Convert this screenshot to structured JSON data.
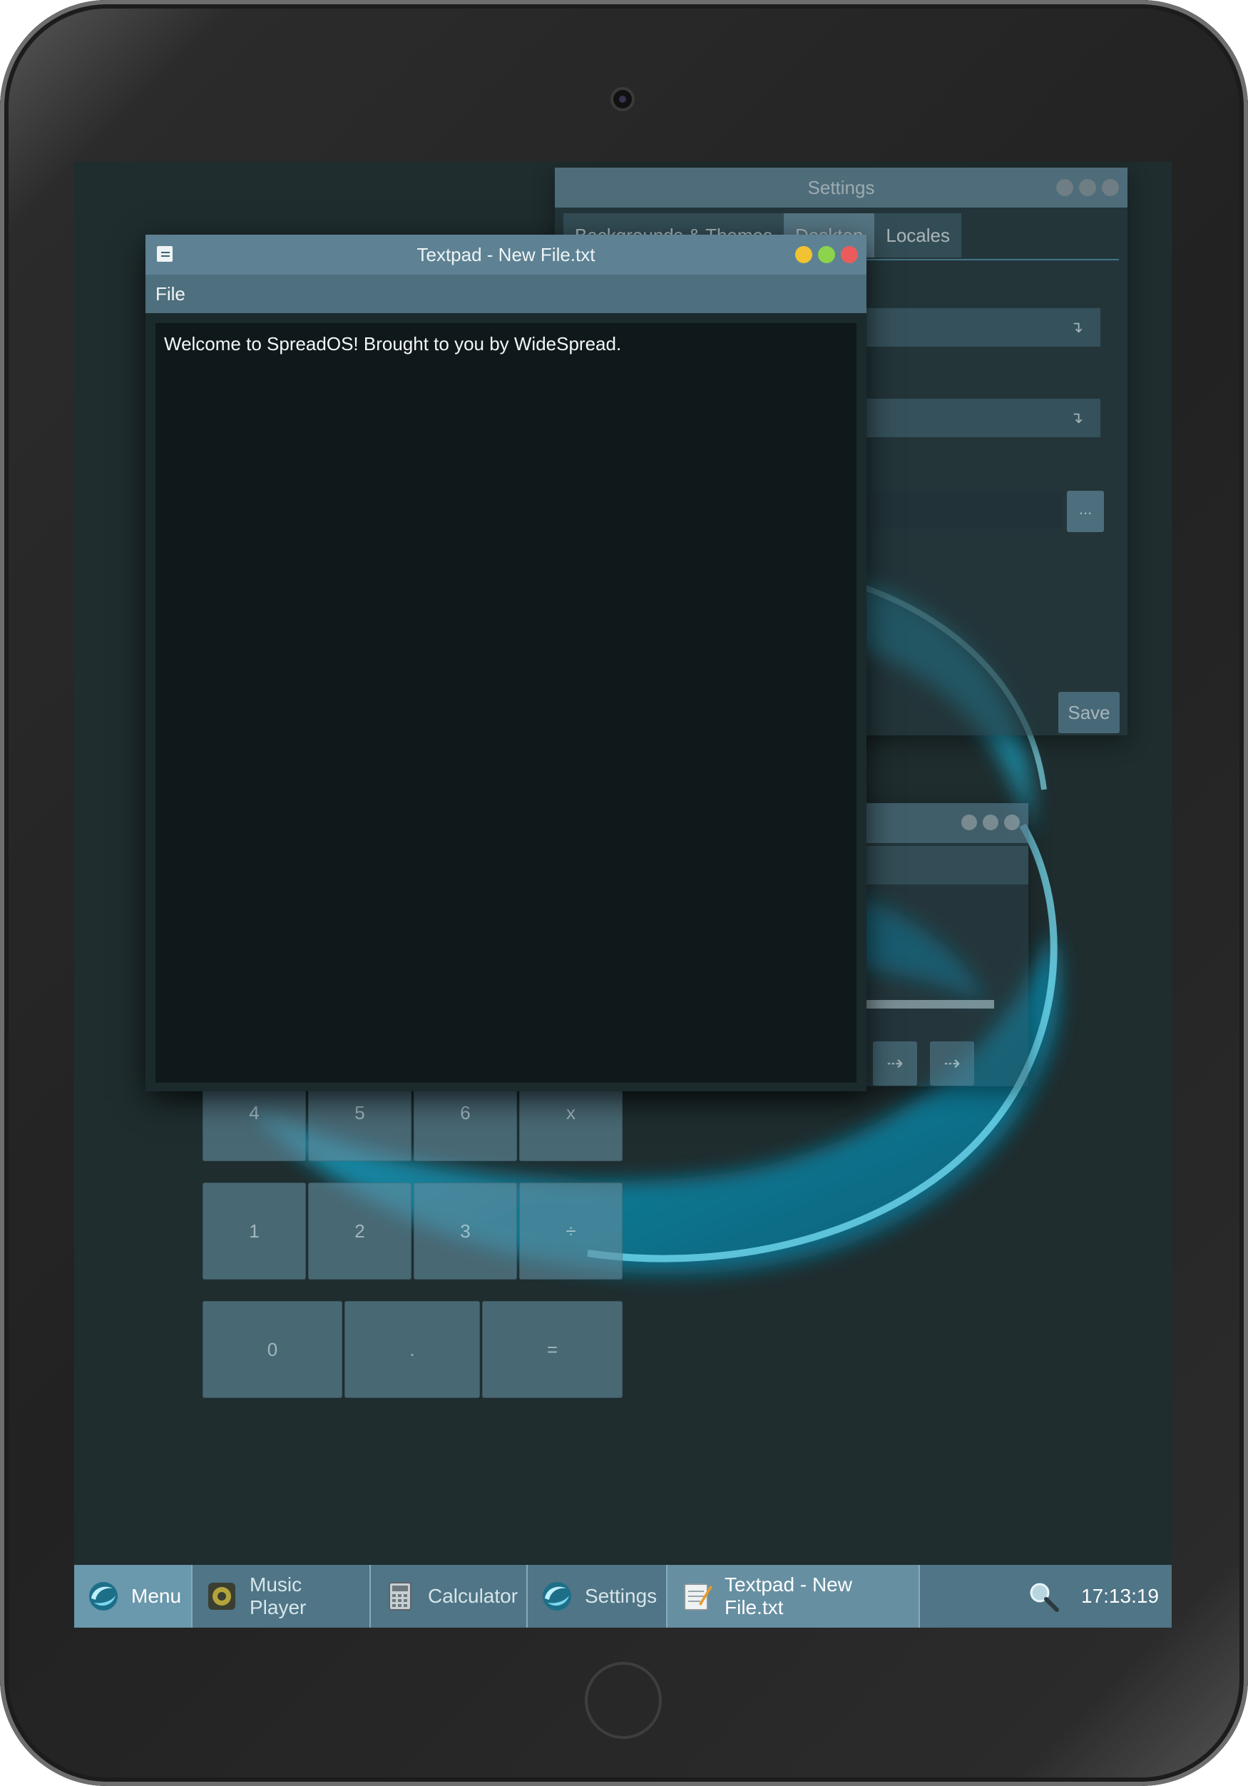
{
  "settings_window": {
    "title": "Settings",
    "tabs": [
      "Backgrounds & Themes",
      "Desktop",
      "Locales"
    ],
    "browse_label": "...",
    "save_label": "Save"
  },
  "music_window": {
    "prev_label": "⇢",
    "next_label": "⇢"
  },
  "calculator": {
    "keys_row1": [
      "4",
      "5",
      "6",
      "x"
    ],
    "keys_row2": [
      "1",
      "2",
      "3",
      "÷"
    ],
    "keys_row3": [
      "0",
      ".",
      "="
    ]
  },
  "textpad": {
    "title": "Textpad - New File.txt",
    "menu_file": "File",
    "content": "Welcome to SpreadOS! Brought to you by WideSpread."
  },
  "taskbar": {
    "menu_label": "Menu",
    "items": [
      {
        "label": "Music Player",
        "icon": "speaker-icon"
      },
      {
        "label": "Calculator",
        "icon": "calculator-icon"
      },
      {
        "label": "Settings",
        "icon": "spreados-logo-icon"
      },
      {
        "label": "Textpad - New File.txt",
        "icon": "notepad-icon"
      }
    ],
    "clock": "17:13:19"
  },
  "colors": {
    "accent": "#5e8293",
    "taskbar": "#4f7586",
    "desktop": "#1f2d2f"
  }
}
